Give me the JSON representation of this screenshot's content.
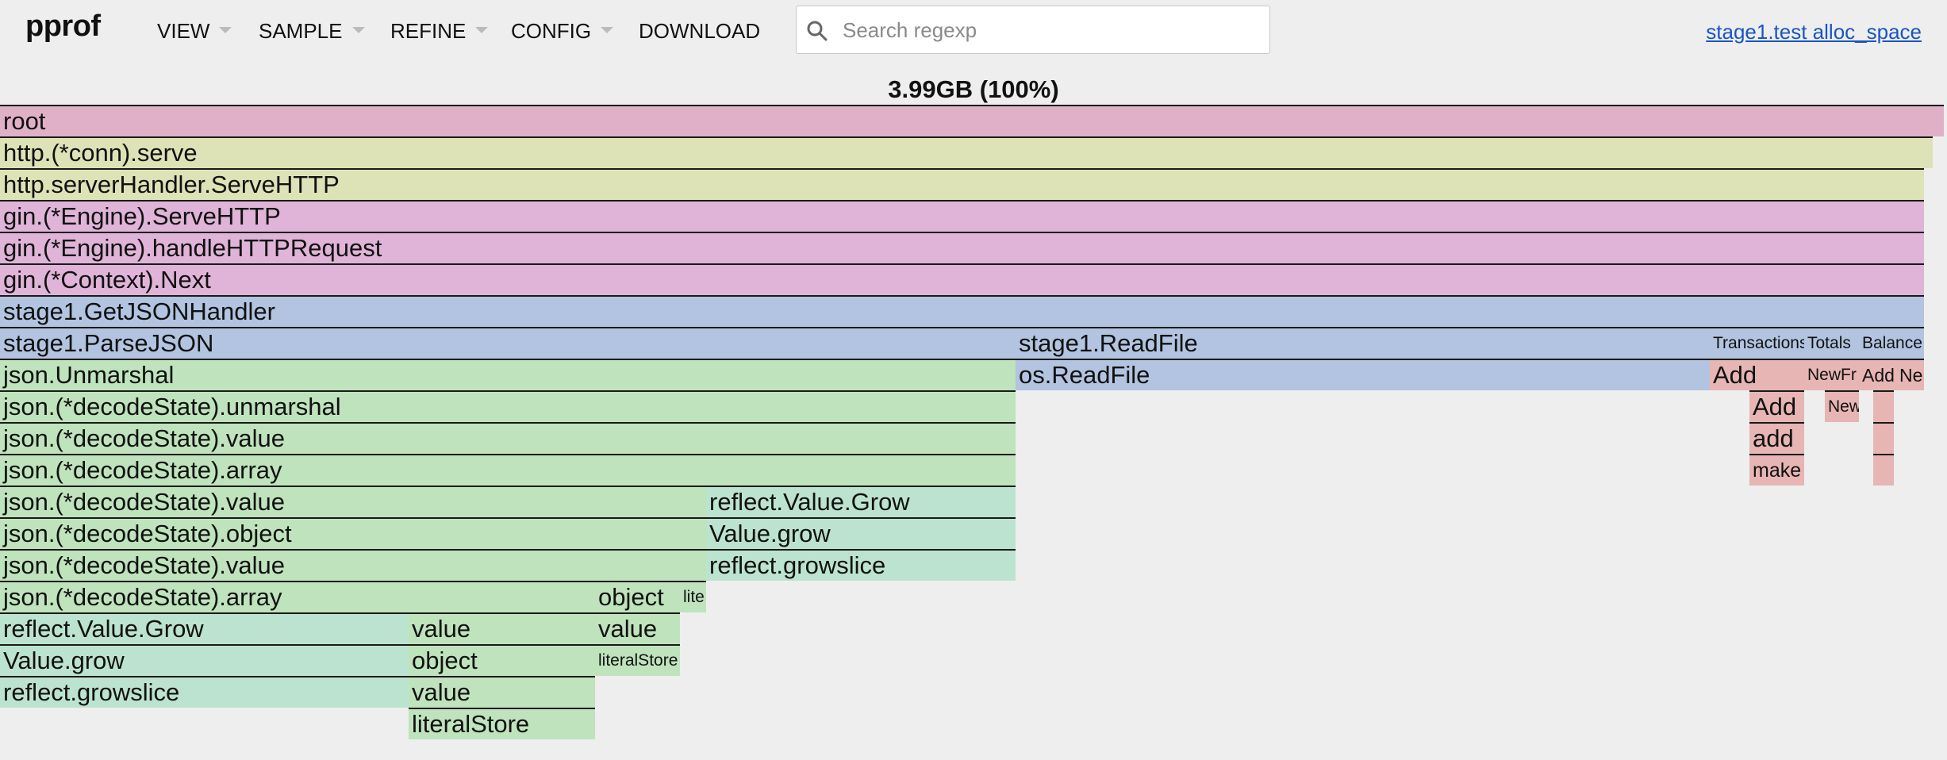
{
  "header": {
    "logo": "pprof",
    "menus": [
      "VIEW",
      "SAMPLE",
      "REFINE",
      "CONFIG",
      "DOWNLOAD"
    ],
    "search_placeholder": "Search regexp",
    "profile_link": "stage1.test alloc_space"
  },
  "flamegraph": {
    "title": "3.99GB (100%)",
    "frames": [
      {
        "label": "root",
        "color": "#e0b1c6"
      },
      {
        "label": "http.(*conn).serve",
        "color": "#dde3b6"
      },
      {
        "label": "http.serverHandler.ServeHTTP",
        "color": "#dde3b6"
      },
      {
        "label": "gin.(*Engine).ServeHTTP",
        "color": "#dfb4d8"
      },
      {
        "label": "gin.(*Engine).handleHTTPRequest",
        "color": "#dfb4d8"
      },
      {
        "label": "gin.(*Context).Next",
        "color": "#dfb4d8"
      },
      {
        "label": "stage1.GetJSONHandler",
        "color": "#b2c4e0"
      },
      {
        "label": "stage1.ParseJSON",
        "color": "#b2c4e0"
      },
      {
        "label": "stage1.ReadFile",
        "color": "#b2c4e0"
      },
      {
        "label": "Transactions",
        "color": "#b2c4e0"
      },
      {
        "label": "Totals",
        "color": "#b2c4e0"
      },
      {
        "label": "Balance",
        "color": "#b2c4e0"
      },
      {
        "label": "json.Unmarshal",
        "color": "#bfe3bc"
      },
      {
        "label": "os.ReadFile",
        "color": "#b2c4e0"
      },
      {
        "label": "Add",
        "color": "#e6b5b4"
      },
      {
        "label": "NewFr",
        "color": "#e6b5b4"
      },
      {
        "label": "Add",
        "color": "#e6b5b4"
      },
      {
        "label": "Ne",
        "color": "#e6b5b4"
      },
      {
        "label": "json.(*decodeState).unmarshal",
        "color": "#bfe3bc"
      },
      {
        "label": "Add",
        "color": "#e6b5b4"
      },
      {
        "label": "New",
        "color": "#e6b5b4"
      },
      {
        "label": "json.(*decodeState).value",
        "color": "#bfe3bc"
      },
      {
        "label": "add",
        "color": "#e6b5b4"
      },
      {
        "label": "json.(*decodeState).array",
        "color": "#bfe3bc"
      },
      {
        "label": "make",
        "color": "#e6b5b4"
      },
      {
        "label": "json.(*decodeState).value",
        "color": "#bfe3bc"
      },
      {
        "label": "reflect.Value.Grow",
        "color": "#bce3cf"
      },
      {
        "label": "json.(*decodeState).object",
        "color": "#bfe3bc"
      },
      {
        "label": "Value.grow",
        "color": "#bce3cf"
      },
      {
        "label": "json.(*decodeState).value",
        "color": "#bfe3bc"
      },
      {
        "label": "reflect.growslice",
        "color": "#bce3cf"
      },
      {
        "label": "json.(*decodeState).array",
        "color": "#bfe3bc"
      },
      {
        "label": "object",
        "color": "#bfe3bc"
      },
      {
        "label": "lite",
        "color": "#bfe3bc"
      },
      {
        "label": "reflect.Value.Grow",
        "color": "#bce3cf"
      },
      {
        "label": "value",
        "color": "#bfe3bc"
      },
      {
        "label": "value",
        "color": "#bfe3bc"
      },
      {
        "label": "Value.grow",
        "color": "#bce3cf"
      },
      {
        "label": "object",
        "color": "#bfe3bc"
      },
      {
        "label": "literalStore",
        "color": "#bfe3bc"
      },
      {
        "label": "reflect.growslice",
        "color": "#bce3cf"
      },
      {
        "label": "value",
        "color": "#bfe3bc"
      },
      {
        "label": "literalStore",
        "color": "#bfe3bc"
      },
      {
        "label": "",
        "color": "#e6b5b4"
      },
      {
        "label": "",
        "color": "#e6b5b4"
      },
      {
        "label": "",
        "color": "#e6b5b4"
      }
    ]
  }
}
